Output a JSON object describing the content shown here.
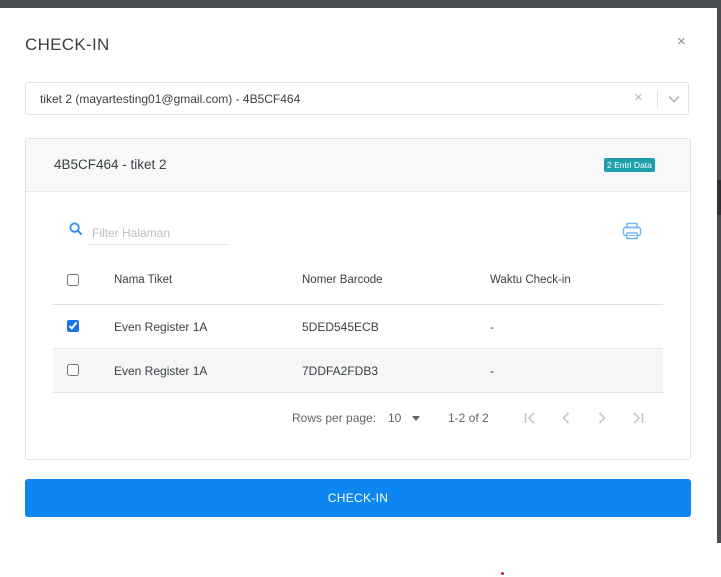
{
  "modal": {
    "title": "CHECK-IN",
    "close_glyph": "×"
  },
  "ticket_select": {
    "value": "tiket 2 (mayartesting01@gmail.com) - 4B5CF464",
    "clear_glyph": "×"
  },
  "card": {
    "title": "4B5CF464 - tiket 2",
    "badge": "2 Entri Data"
  },
  "filter": {
    "placeholder": "Filter Halaman",
    "value": ""
  },
  "table": {
    "columns": [
      "Nama Tiket",
      "Nomer Barcode",
      "Waktu Check-in"
    ],
    "rows": [
      {
        "checked": true,
        "nama_tiket": "Even Register 1A",
        "barcode": "5DED545ECB",
        "waktu": "-"
      },
      {
        "checked": false,
        "nama_tiket": "Even Register 1A",
        "barcode": "7DDFA2FDB3",
        "waktu": "-"
      }
    ]
  },
  "pagination": {
    "rows_label": "Rows per page:",
    "rows_value": "10",
    "range": "1-2 of 2"
  },
  "submit_label": "CHECK-IN",
  "icons": {
    "search": "search-icon",
    "print": "print-icon",
    "chevron": "chevron-down-icon",
    "first": "first-page-icon",
    "prev": "chevron-left-icon",
    "next": "chevron-right-icon",
    "last": "last-page-icon"
  },
  "colors": {
    "primary": "#0d86f2",
    "badge": "#1f9eab",
    "checkbox": "#1a73e8"
  }
}
